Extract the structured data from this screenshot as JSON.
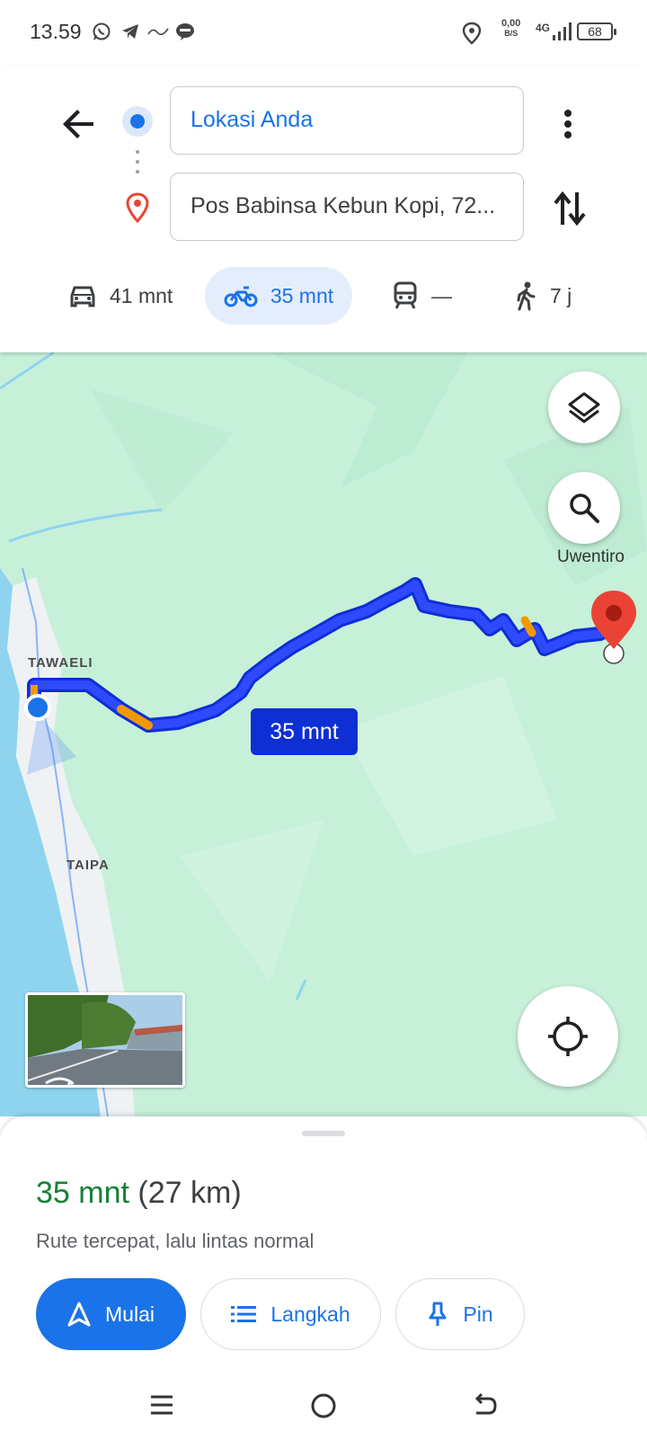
{
  "status_bar": {
    "time": "13.59",
    "data_speed": "0,00",
    "data_unit": "B/S",
    "network": "4G",
    "battery": "68"
  },
  "directions": {
    "origin": "Lokasi Anda",
    "destination": "Pos Babinsa Kebun Kopi, 72..."
  },
  "modes": [
    {
      "label": "41 mnt",
      "icon": "car-icon"
    },
    {
      "label": "35 mnt",
      "icon": "motorcycle-icon",
      "selected": true
    },
    {
      "label": "—",
      "icon": "transit-icon"
    },
    {
      "label": "7 j",
      "icon": "walk-icon"
    }
  ],
  "map": {
    "labels": [
      "TAWAELI",
      "TAIPA",
      "Uwentiro"
    ],
    "route_time": "35 mnt"
  },
  "sheet": {
    "duration": "35 mnt",
    "distance": "(27 km)",
    "description": "Rute tercepat, lalu lintas normal",
    "buttons": {
      "start": "Mulai",
      "steps": "Langkah",
      "pin": "Pin"
    }
  },
  "colors": {
    "accent": "#1a73e8",
    "route": "#0d2fd4",
    "traffic_slow": "#f29900",
    "duration_green": "#188038",
    "map_land": "#c7f0d9",
    "water": "#8fd4ef",
    "pin_red": "#ea4335"
  }
}
